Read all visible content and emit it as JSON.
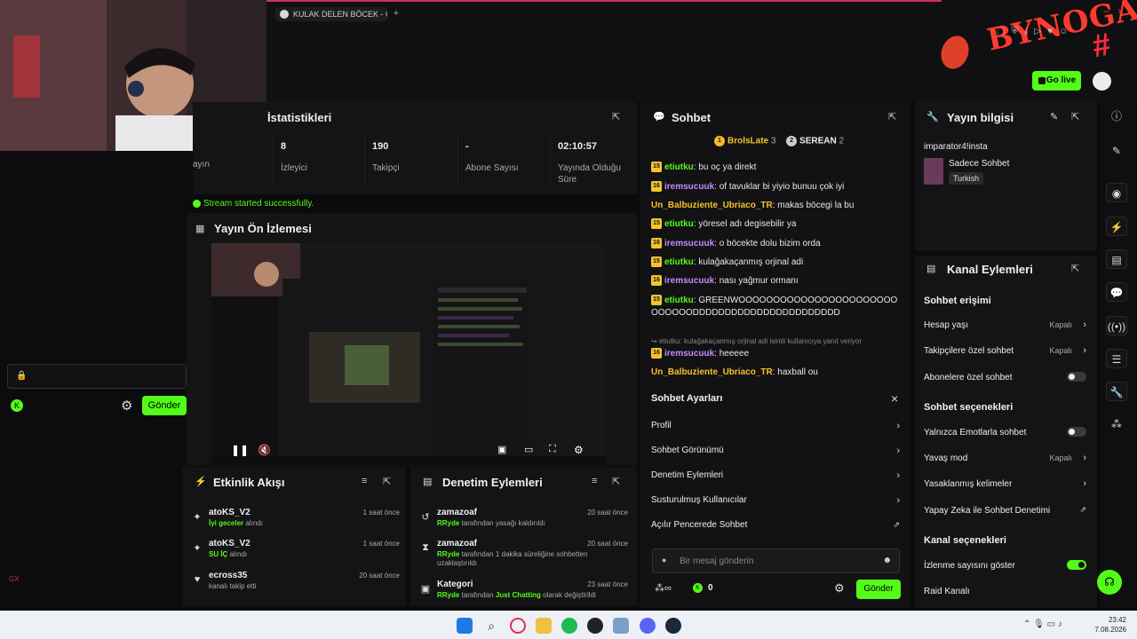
{
  "browser": {
    "tab_title": "KULAK DELEN BÖCEK - Go",
    "new_tab": "+",
    "go_live": "Go live"
  },
  "brand": {
    "logo_text": "BYNOGA",
    "hash": "#"
  },
  "left": {
    "lock_placeholder": "🔒",
    "send": "Gönder",
    "footer_mark": "GX"
  },
  "stats": {
    "title": "İstatistikleri",
    "partial_label": "ayın",
    "cells": [
      {
        "value": "8",
        "label": "İzleyici"
      },
      {
        "value": "190",
        "label": "Takipçi"
      },
      {
        "value": "-",
        "label": "Abone Sayısı"
      },
      {
        "value": "02:10:57",
        "label": "Yayında Olduğu Süre"
      }
    ],
    "message": "Stream started successfully."
  },
  "preview": {
    "title": "Yayın Ön İzlemesi"
  },
  "activity": {
    "title": "Etkinlik Akışı",
    "items": [
      {
        "user": "atoKS_V2",
        "highlight": "İyi geceler",
        "text": " alındı",
        "time": "1 saat önce",
        "icon": "gift-icon"
      },
      {
        "user": "atoKS_V2",
        "highlight": "SU İÇ",
        "text": " alındı",
        "time": "1 saat önce",
        "icon": "gift-icon"
      },
      {
        "user": "ecross35",
        "highlight": "",
        "text": "kanalı takip etti",
        "time": "20 saat önce",
        "icon": "heart-icon"
      }
    ]
  },
  "moderation": {
    "title": "Denetim Eylemleri",
    "items": [
      {
        "user": "zamazoaf",
        "actor": "RRyde",
        "text": " tarafından yasağı kaldırıldı",
        "time": "20 saat önce",
        "icon": "unban-icon"
      },
      {
        "user": "zamazoaf",
        "actor": "RRyde",
        "text": " tarafından 1 dakika süreliğine sohbetten uzaklaştırıldı",
        "time": "20 saat önce",
        "icon": "timeout-icon"
      },
      {
        "user": "Kategori",
        "actor": "RRyde",
        "text": " tarafından ",
        "extra": "Just Chatting",
        "extra_text": " olarak değiştirildi",
        "time": "23 saat önce",
        "icon": "category-icon"
      }
    ]
  },
  "chat": {
    "title": "Sohbet",
    "top_users": [
      {
        "rank": "1",
        "name": "BrolsLate",
        "count": "3"
      },
      {
        "rank": "2",
        "name": "SEREAN",
        "count": "2"
      }
    ],
    "messages": [
      {
        "badge": "15",
        "user": "etiutku",
        "color": "green",
        "text": "bu oç ya direkt"
      },
      {
        "badge": "16",
        "user": "iremsucuuk",
        "color": "purple",
        "text": "of tavuklar bi yiyio bunuu çok iyi"
      },
      {
        "badge": "",
        "user": "Un_Balbuziente_Ubriaco_TR",
        "color": "yellow",
        "text": "makas böcegi la bu"
      },
      {
        "badge": "15",
        "user": "etiutku",
        "color": "green",
        "text": "yöresel adı degisebilir ya"
      },
      {
        "badge": "16",
        "user": "iremsucuuk",
        "color": "purple",
        "text": "o böcekte dolu bizim orda"
      },
      {
        "badge": "15",
        "user": "etiutku",
        "color": "green",
        "text": "kulağakaçanmış orjinal adi"
      },
      {
        "badge": "16",
        "user": "iremsucuuk",
        "color": "purple",
        "text": "nası yağmur ormanı"
      },
      {
        "badge": "15",
        "user": "etiutku",
        "color": "green",
        "text": "GREENWOOOOOOOOOOOOOOOOOOOOOOOOOOOOODDDDDDDDDDDDDDDDDDDDDDD"
      },
      {
        "badge": "16",
        "user": "iremsucuuk",
        "color": "purple",
        "text": "heeeee"
      },
      {
        "badge": "",
        "user": "Un_Balbuziente_Ubriaco_TR",
        "color": "yellow",
        "text": "haxball ou"
      }
    ],
    "reply_note": "etiutku: kulağakaçanmış orjinal adi isimli kullanıcıya yanıt veriyor",
    "settings": {
      "title": "Sohbet Ayarları",
      "close": "×",
      "rows": [
        "Profil",
        "Sohbet Görünümü",
        "Denetim Eylemleri",
        "Susturulmuş Kullanıcılar",
        "Açılır Pencerede Sohbet"
      ]
    },
    "input_placeholder": "Bir mesaj gönderin",
    "count": "0",
    "send": "Gönder"
  },
  "info": {
    "title": "Yayın bilgisi",
    "stream_title": "imparator4!insta",
    "category": "Sadece Sohbet",
    "language": "Turkish"
  },
  "channel": {
    "title": "Kanal Eylemleri",
    "chat_access_h": "Sohbet erişimi",
    "rows_access": [
      {
        "label": "Hesap yaşı",
        "value": "Kapalı",
        "kind": "chev"
      },
      {
        "label": "Takipçilere özel sohbet",
        "value": "Kapalı",
        "kind": "chev"
      },
      {
        "label": "Abonelere özel sohbet",
        "value": "",
        "kind": "toggle-off"
      }
    ],
    "chat_options_h": "Sohbet seçenekleri",
    "rows_options": [
      {
        "label": "Yalnızca Emotlarla sohbet",
        "value": "",
        "kind": "toggle-off"
      },
      {
        "label": "Yavaş mod",
        "value": "Kapalı",
        "kind": "chev"
      },
      {
        "label": "Yasaklanmış kelimeler",
        "value": "",
        "kind": "chev"
      },
      {
        "label": "Yapay Zeka ile Sohbet Denetimi",
        "value": "",
        "kind": "external"
      }
    ],
    "channel_options_h": "Kanal seçenekleri",
    "rows_channel": [
      {
        "label": "İzlenme sayısını göster",
        "value": "",
        "kind": "toggle-on"
      },
      {
        "label": "Raid Kanalı",
        "value": "",
        "kind": "none"
      }
    ]
  },
  "taskbar": {
    "time": "23:42",
    "date": "7.08.2026"
  },
  "colors": {
    "accent": "#53fc18",
    "panel": "#141416",
    "background": "#0b0b0c"
  }
}
